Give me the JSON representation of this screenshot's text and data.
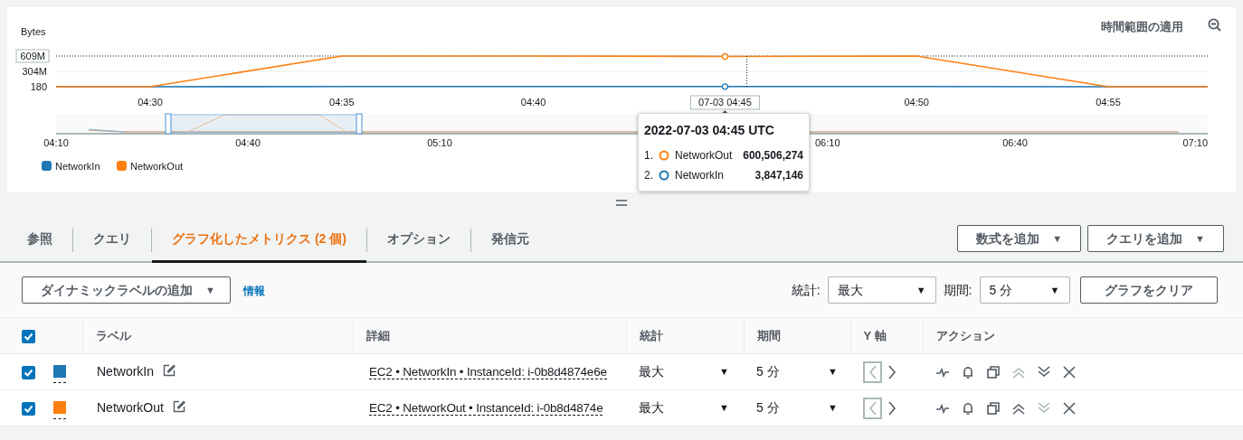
{
  "chart": {
    "apply_link": "時間範囲の適用",
    "chart_data": {
      "type": "line",
      "ylabel": "Bytes",
      "categories": [
        "04:30",
        "04:35",
        "04:40",
        null,
        "04:50",
        "04:55"
      ],
      "ylim": [
        180,
        609000000
      ],
      "legend": "bottom-left",
      "series": [
        {
          "name": "NetworkIn",
          "color": "#1f77b4",
          "values": [
            180,
            4000000,
            4000000,
            4000000,
            4000000,
            180
          ]
        },
        {
          "name": "NetworkOut",
          "color": "#ff7f0e",
          "values": [
            180,
            609000000,
            609000000,
            600000000,
            609000000,
            180
          ]
        }
      ],
      "yticks": [
        {
          "value": 180,
          "label": "180"
        },
        {
          "value": 304000000,
          "label": "304M"
        },
        {
          "value": 609000000,
          "label": "609M"
        }
      ]
    },
    "hover_label": "07-03 04:45",
    "navigator": {
      "labels": [
        "04:10",
        "04:40",
        "05:10",
        "06:10",
        "06:40",
        "07:10"
      ]
    },
    "tooltip": {
      "title": "2022-07-03 04:45 UTC",
      "rows": [
        {
          "index": "1.",
          "name": "NetworkOut",
          "value": "600,506,274",
          "color": "#ff7f0e"
        },
        {
          "index": "2.",
          "name": "NetworkIn",
          "value": "3,847,146",
          "color": "#1f77b4"
        }
      ]
    }
  },
  "tabs": [
    {
      "label": "参照",
      "selected": false
    },
    {
      "label": "クエリ",
      "selected": false
    },
    {
      "label": "グラフ化したメトリクス (2 個)",
      "selected": true
    },
    {
      "label": "オプション",
      "selected": false
    },
    {
      "label": "発信元",
      "selected": false
    }
  ],
  "tab_buttons": [
    {
      "label": "数式を追加",
      "caret": "▼"
    },
    {
      "label": "クエリを追加",
      "caret": "▼"
    }
  ],
  "toolbar": {
    "dynamic_label_button": {
      "label": "ダイナミックラベルの追加",
      "caret": "▼"
    },
    "info_link": "情報",
    "stat_label": "統計:",
    "stat_value": "最大",
    "stat_caret": "▼",
    "period_label": "期間:",
    "period_value": "5 分",
    "period_caret": "▼",
    "clear_button": "グラフをクリア"
  },
  "table": {
    "all_checked": true,
    "columns": [
      "ラベル",
      "詳細",
      "統計",
      "期間",
      "Y 軸",
      "アクション"
    ],
    "rows": [
      {
        "checked": true,
        "color": "#1f77b4",
        "label": "NetworkIn",
        "detail": "EC2 • NetworkIn • InstanceId: i-0b8d4874e6e",
        "stat": "最大",
        "stat_caret": "▼",
        "period": "5 分",
        "period_caret": "▼",
        "left_axis_selected": true,
        "move_up_disabled": true,
        "move_down_disabled": false
      },
      {
        "checked": true,
        "color": "#ff7f0e",
        "label": "NetworkOut",
        "detail": "EC2 • NetworkOut • InstanceId: i-0b8d4874e",
        "stat": "最大",
        "stat_caret": "▼",
        "period": "5 分",
        "period_caret": "▼",
        "left_axis_selected": true,
        "move_up_disabled": false,
        "move_down_disabled": true
      }
    ]
  }
}
